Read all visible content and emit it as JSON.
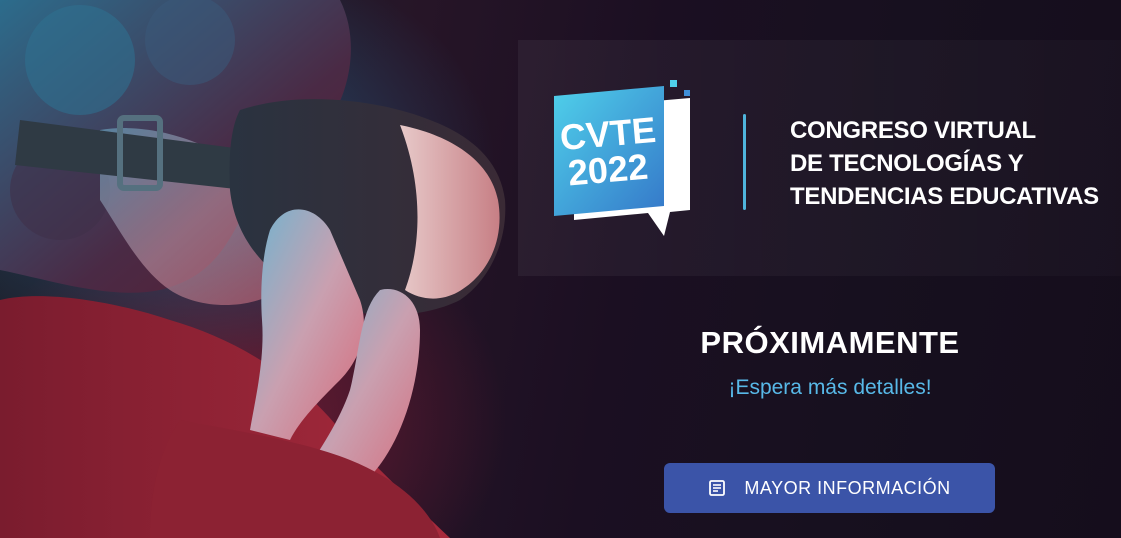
{
  "logo": {
    "line1": "CVTE",
    "line2": "2022"
  },
  "title": {
    "lines": [
      "CONGRESO VIRTUAL",
      "DE TECNOLOGÍAS Y",
      "TENDENCIAS EDUCATIVAS"
    ]
  },
  "announcement": {
    "heading": "PRÓXIMAMENTE",
    "subheading": "¡Espera más detalles!"
  },
  "cta": {
    "label": "MAYOR INFORMACIÓN",
    "icon": "newspaper-icon"
  },
  "colors": {
    "accent": "#58b9e8",
    "button": "#3b54a8",
    "divider": "#4fb4dc",
    "background": "#1a0d1f"
  }
}
